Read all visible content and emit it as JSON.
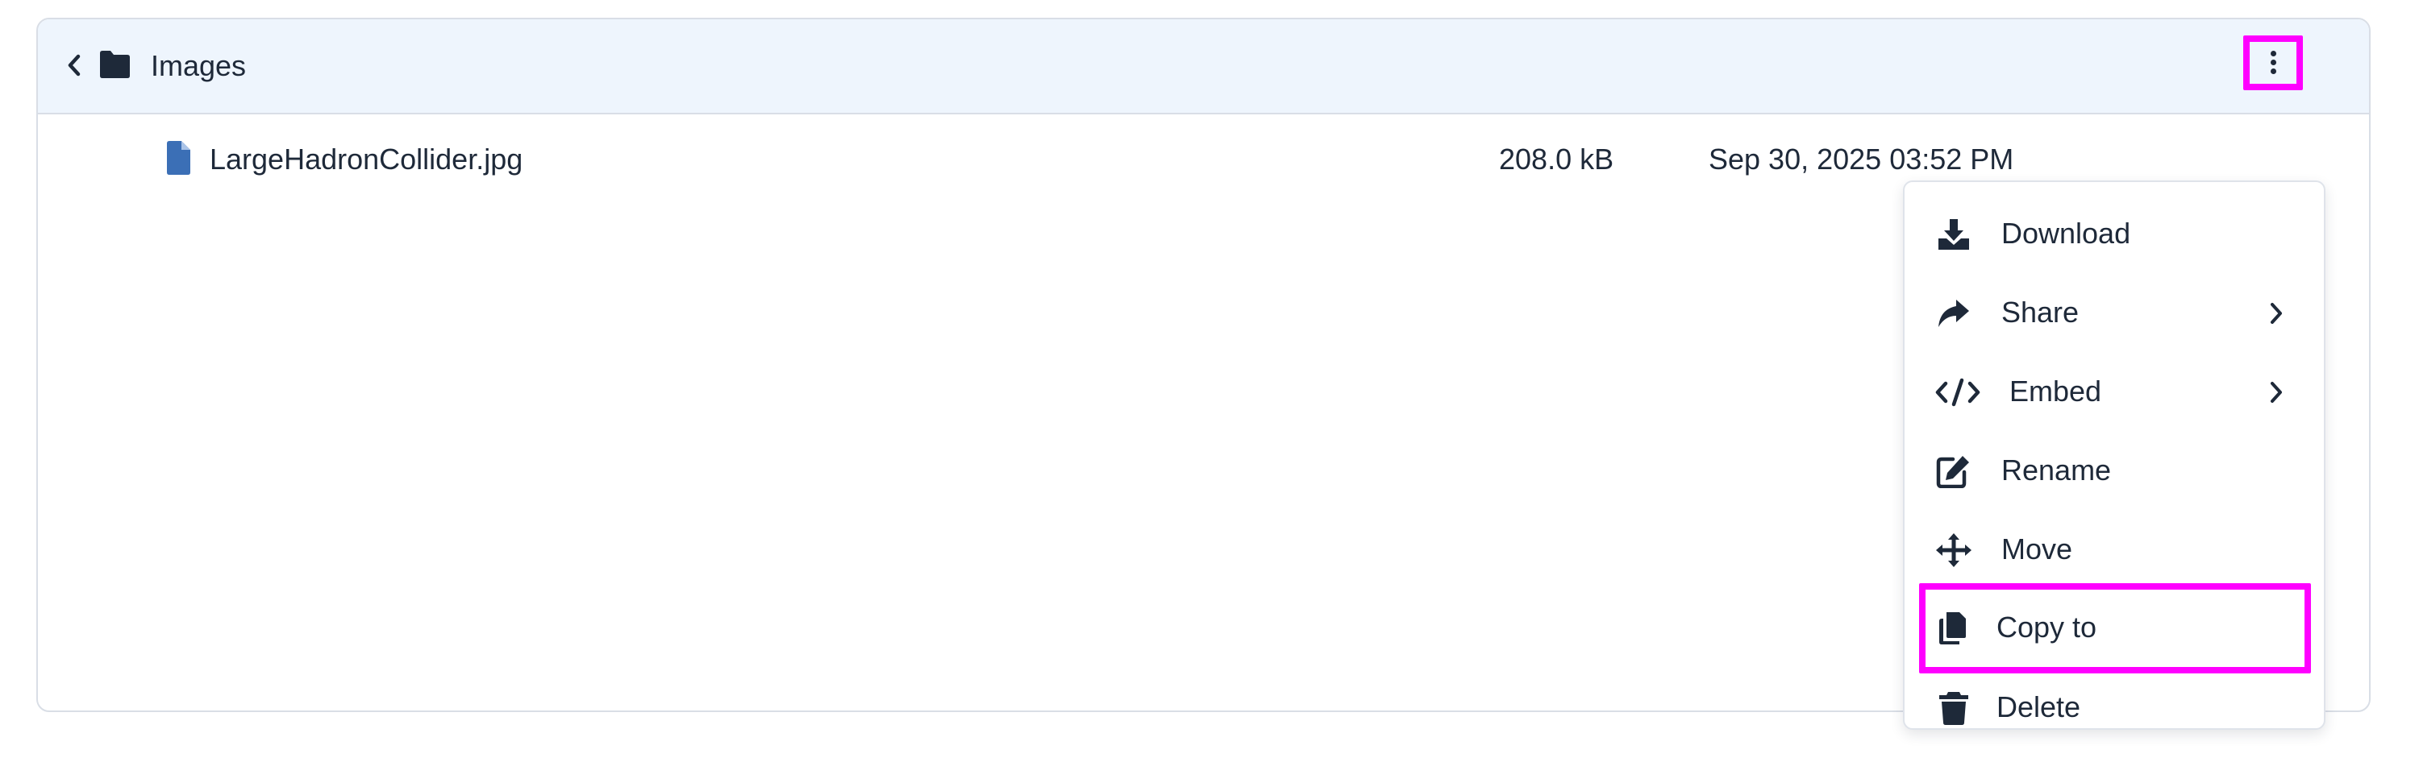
{
  "header": {
    "folder_name": "Images"
  },
  "file": {
    "name": "LargeHadronCollider.jpg",
    "size": "208.0 kB",
    "modified": "Sep 30, 2025 03:52 PM"
  },
  "context_menu": {
    "items": [
      {
        "label": "Download",
        "icon": "download-icon",
        "has_submenu": false
      },
      {
        "label": "Share",
        "icon": "share-icon",
        "has_submenu": true
      },
      {
        "label": "Embed",
        "icon": "code-icon",
        "has_submenu": true
      },
      {
        "label": "Rename",
        "icon": "edit-icon",
        "has_submenu": false
      },
      {
        "label": "Move",
        "icon": "move-icon",
        "has_submenu": false
      },
      {
        "label": "Copy to",
        "icon": "copy-icon",
        "has_submenu": false,
        "highlighted": true
      },
      {
        "label": "Delete",
        "icon": "trash-icon",
        "has_submenu": false
      }
    ]
  },
  "colors": {
    "header_bg": "#eef5fd",
    "text": "#1e2939",
    "file_icon": "#3b6fb6",
    "highlight": "#ff00ff"
  }
}
